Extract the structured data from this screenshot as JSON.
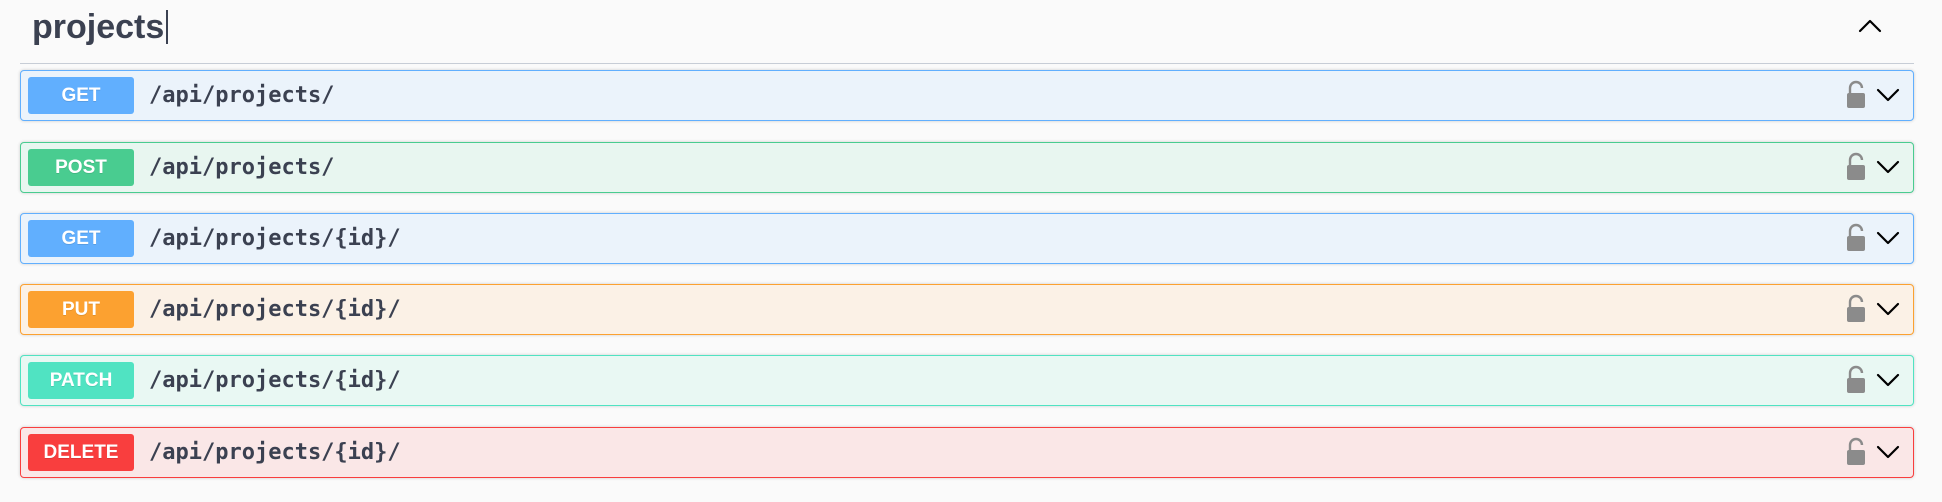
{
  "section": {
    "title": "projects",
    "toggle_icon": "chevron-up-icon"
  },
  "colors": {
    "get": "#61affe",
    "post": "#49cc90",
    "put": "#fca130",
    "patch": "#50e3c2",
    "delete": "#f93e3e",
    "text": "#3b4151"
  },
  "operations": [
    {
      "method": "GET",
      "path": "/api/projects/",
      "lock_icon": "unlocked-icon",
      "expand_icon": "chevron-down-icon"
    },
    {
      "method": "POST",
      "path": "/api/projects/",
      "lock_icon": "unlocked-icon",
      "expand_icon": "chevron-down-icon"
    },
    {
      "method": "GET",
      "path": "/api/projects/{id}/",
      "lock_icon": "unlocked-icon",
      "expand_icon": "chevron-down-icon"
    },
    {
      "method": "PUT",
      "path": "/api/projects/{id}/",
      "lock_icon": "unlocked-icon",
      "expand_icon": "chevron-down-icon"
    },
    {
      "method": "PATCH",
      "path": "/api/projects/{id}/",
      "lock_icon": "unlocked-icon",
      "expand_icon": "chevron-down-icon"
    },
    {
      "method": "DELETE",
      "path": "/api/projects/{id}/",
      "lock_icon": "unlocked-icon",
      "expand_icon": "chevron-down-icon"
    }
  ]
}
